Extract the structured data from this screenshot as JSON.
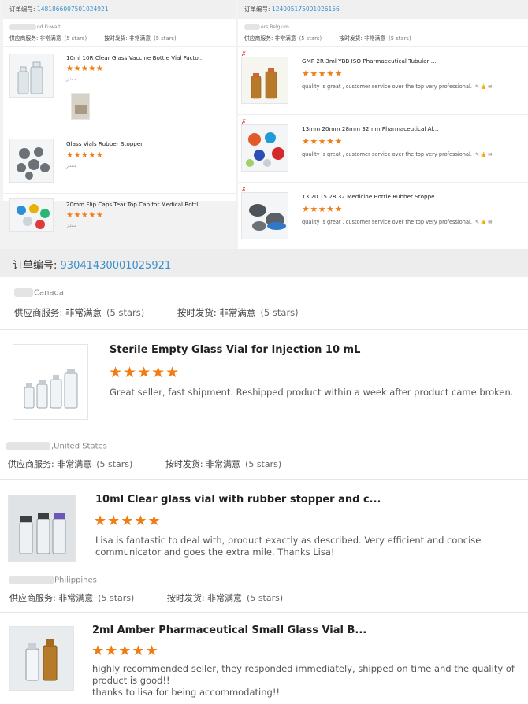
{
  "orders_top": [
    {
      "label": "订单编号:",
      "order_no": "1481866007501024921",
      "location": "nd,Kuwait",
      "service_label": "供应商服务: 非常满意",
      "service_rating": "(5 stars)",
      "ship_label": "按时发货: 非常满意",
      "ship_rating": "(5 stars)",
      "items": [
        {
          "title": "10ml 10R Clear Glass Vaccine Bottle Vial Facto...",
          "stars": "★★★★★",
          "comment": "ممتاز"
        },
        {
          "title": "Glass Vials Rubber Stopper",
          "stars": "★★★★★",
          "comment": "ممتاز"
        },
        {
          "title": "20mm Flip Caps Tear Top Cap for Medical Bottl...",
          "stars": "★★★★★",
          "comment": "ممتاز"
        }
      ]
    },
    {
      "label": "订单编号:",
      "order_no": "124005175001026156",
      "location": "ers,Belgium",
      "service_label": "供应商服务: 非常满意",
      "service_rating": "(5 stars)",
      "ship_label": "按时发货: 非常满意",
      "ship_rating": "(5 stars)",
      "items": [
        {
          "title": "GMP 2R 3ml YBB ISO Pharmaceutical Tubular ...",
          "stars": "★★★★★",
          "comment": "quality is great , customer service over the top very professional.",
          "icons": "✎ 👍 ✉"
        },
        {
          "title": "13mm 20mm 28mm 32mm Pharmaceutical Al...",
          "stars": "★★★★★",
          "comment": "quality is great , customer service over the top very professional.",
          "icons": "✎ 👍 ✉"
        },
        {
          "title": "13 20 15 28 32 Medicine Bottle Rubber Stoppe...",
          "stars": "★★★★★",
          "comment": "quality is great , customer service over the top very professional.",
          "icons": "✎ 👍 ✉"
        }
      ]
    }
  ],
  "order_main": {
    "label": "订单编号:",
    "order_no": "93041430001025921"
  },
  "reviews": [
    {
      "country": "Canada",
      "service_label": "供应商服务: 非常满意",
      "service_rating": "(5 stars)",
      "ship_label": "按时发货: 非常满意",
      "ship_rating": "(5 stars)",
      "title": "Sterile Empty Glass Vial for Injection 10 mL",
      "stars": "★★★★★",
      "comment": "Great seller, fast shipment. Reshipped product within a week after product came broken."
    },
    {
      "country": ",United States",
      "service_label": "供应商服务: 非常满意",
      "service_rating": "(5 stars)",
      "ship_label": "按时发货: 非常满意",
      "ship_rating": "(5 stars)",
      "title": "10ml Clear glass vial with rubber stopper and c...",
      "stars": "★★★★★",
      "comment": "Lisa is fantastic to deal with, product exactly as described. Very efficient and concise communicator and goes the extra mile. Thanks Lisa!"
    },
    {
      "country": "Philippines",
      "service_label": "供应商服务: 非常满意",
      "service_rating": "(5 stars)",
      "ship_label": "按时发货: 非常满意",
      "ship_rating": "(5 stars)",
      "title": "2ml Amber Pharmaceutical Small Glass Vial B...",
      "stars": "★★★★★",
      "comment": "highly recommended seller, they responded immediately, shipped on time and the quality of product is good!!",
      "comment2": "thanks to lisa for being accommodating!!"
    }
  ],
  "colors": {
    "accent": "#3c8ec8",
    "stars": "#f07c12"
  }
}
